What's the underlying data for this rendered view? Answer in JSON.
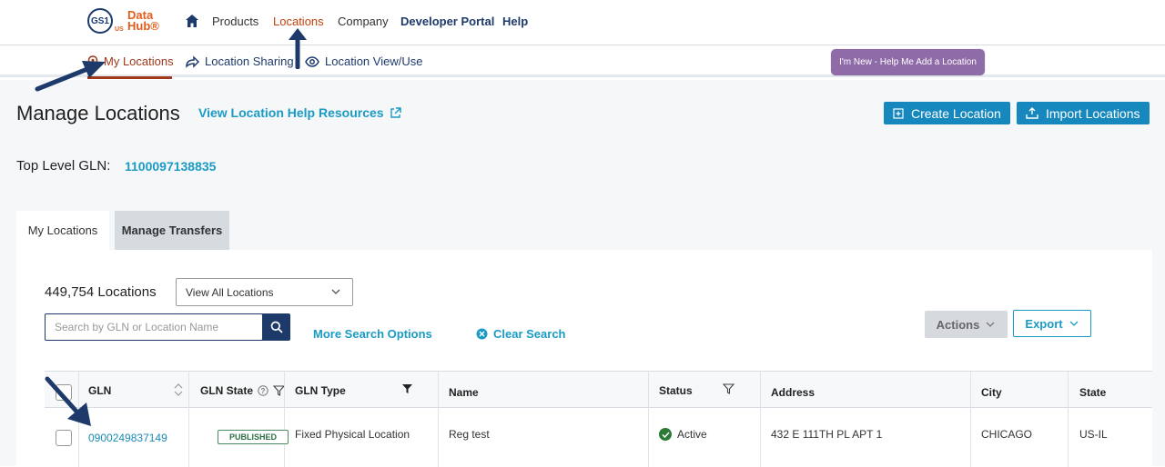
{
  "brand": {
    "logo_mark": "GS1",
    "logo_region": "US",
    "logo_text_1": "Data",
    "logo_text_2": "Hub®"
  },
  "topnav": {
    "products": "Products",
    "locations": "Locations",
    "company": "Company",
    "developer_portal": "Developer Portal",
    "help": "Help"
  },
  "subnav": {
    "my_locations": "My Locations",
    "location_sharing": "Location Sharing",
    "location_view": "Location View/Use"
  },
  "help_badge": "I'm New - Help Me Add a Location",
  "page": {
    "title": "Manage Locations",
    "help_link": "View Location Help Resources",
    "create_location": "Create Location",
    "import_locations": "Import Locations",
    "top_level_label": "Top Level GLN:",
    "top_level_value": "1100097138835"
  },
  "tabs": {
    "my_locations": "My Locations",
    "manage_transfers": "Manage Transfers"
  },
  "filters": {
    "count": "449,754 Locations",
    "select_value": "View All Locations",
    "search_placeholder": "Search by GLN or Location Name",
    "more_search": "More Search Options",
    "clear_search": "Clear Search",
    "actions": "Actions",
    "export": "Export"
  },
  "table": {
    "headers": [
      "GLN",
      "GLN State",
      "GLN Type",
      "Name",
      "Status",
      "Address",
      "City",
      "State"
    ],
    "rows": [
      {
        "gln": "0900249837149",
        "gln_state": "PUBLISHED",
        "gln_type": "Fixed Physical Location",
        "name": "Reg test",
        "status": "Active",
        "address": "432 E 111TH PL APT 1",
        "city": "CHICAGO",
        "state": "US-IL"
      }
    ]
  },
  "colors": {
    "accent": "#1a9bc5",
    "navy": "#1d3a6b",
    "orange": "#c2410c",
    "purple_badge": "#8f6ba8",
    "active_green": "#2d7a36"
  }
}
